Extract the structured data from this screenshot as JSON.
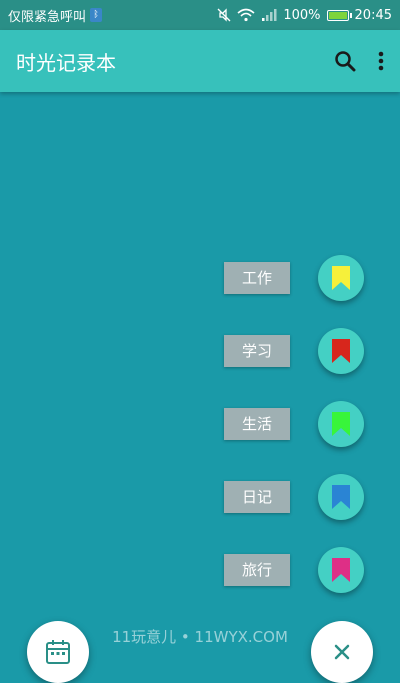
{
  "statusbar": {
    "carrier": "仅限紧急呼叫",
    "battery_percent": "100%",
    "time": "20:45"
  },
  "appbar": {
    "title": "时光记录本",
    "search_icon": "search-icon",
    "more_icon": "more-vert-icon"
  },
  "menu": {
    "items": [
      {
        "label": "工作",
        "color": "#f6f03a",
        "icon": "bookmark-icon"
      },
      {
        "label": "学习",
        "color": "#d7261c",
        "icon": "bookmark-icon"
      },
      {
        "label": "生活",
        "color": "#38f53a",
        "icon": "bookmark-icon"
      },
      {
        "label": "日记",
        "color": "#2a84d4",
        "icon": "bookmark-icon"
      },
      {
        "label": "旅行",
        "color": "#de2f86",
        "icon": "bookmark-icon"
      }
    ]
  },
  "bottom": {
    "calendar_icon": "calendar-icon",
    "close_icon": "close-icon"
  },
  "watermark": "11玩意儿 • 11WYX.COM",
  "colors": {
    "background": "#1a9aa8",
    "appbar": "#37c1bb",
    "statusbar": "#2a8f87",
    "fab": "#44d0c4",
    "label_bg": "#9fb0b3"
  }
}
